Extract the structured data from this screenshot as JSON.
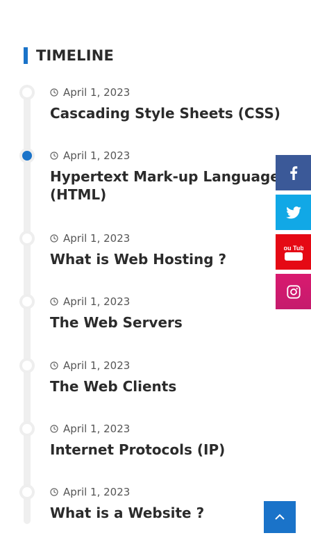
{
  "section": {
    "title": "TIMELINE"
  },
  "timeline": {
    "items": [
      {
        "date": "April 1, 2023",
        "title": "Cascading Style Sheets (CSS)"
      },
      {
        "date": "April 1, 2023",
        "title": "Hypertext Mark-up Language (HTML)"
      },
      {
        "date": "April 1, 2023",
        "title": "What is Web Hosting ?"
      },
      {
        "date": "April 1, 2023",
        "title": "The Web Servers"
      },
      {
        "date": "April 1, 2023",
        "title": "The Web Clients"
      },
      {
        "date": "April 1, 2023",
        "title": "Internet Protocols (IP)"
      },
      {
        "date": "April 1, 2023",
        "title": "What is a Website ?"
      }
    ]
  },
  "social": {
    "facebook_color": "#3b5998",
    "twitter_color": "#11a8e6",
    "youtube_color": "#e50914",
    "instagram_color": "#d91a6f",
    "youtube_text": "You Tube"
  },
  "back_to_top": {
    "icon": "chevron-up-icon",
    "color": "#1a73c9"
  }
}
